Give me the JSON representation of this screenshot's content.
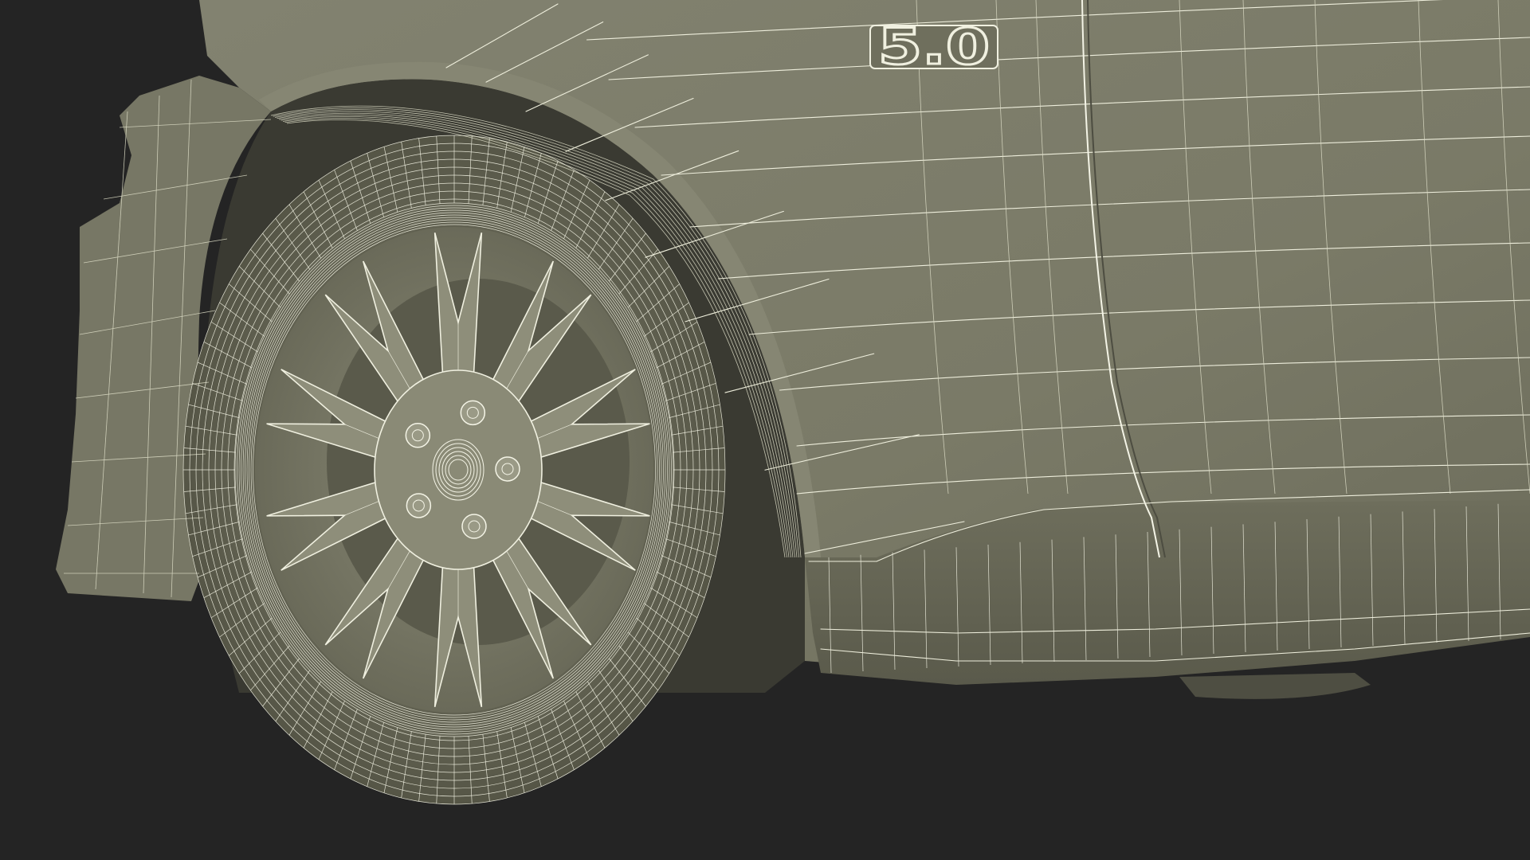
{
  "badge": {
    "text": "5.0"
  },
  "colors": {
    "background": "#242424",
    "body_surface": "#7b7b68",
    "body_shadow": "#5e5e4f",
    "wheel_well": "#3b3b33",
    "wireframe": "#eeeedc"
  },
  "scene": {
    "wheel_spokes": 10,
    "lug_nuts": 5
  }
}
